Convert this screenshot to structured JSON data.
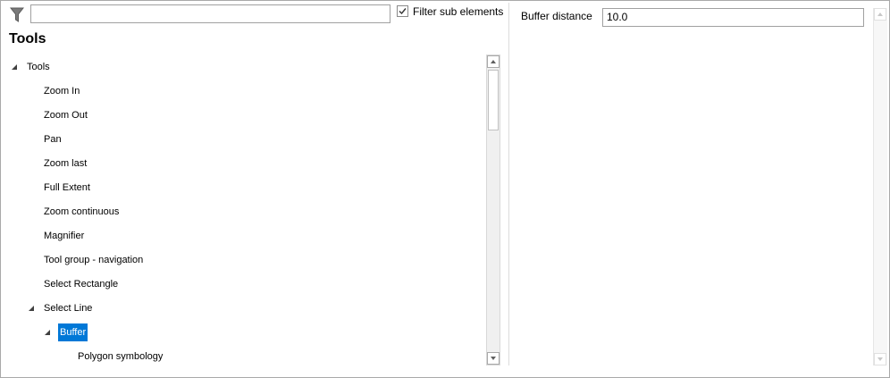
{
  "filter": {
    "icon": "funnel-filter-icon",
    "search_value": "",
    "checkbox_checked": true,
    "checkbox_label": "Filter sub elements"
  },
  "panel_title": "Tools",
  "tree": {
    "items": [
      {
        "label": "Tools",
        "level": 0,
        "expanded": true
      },
      {
        "label": "Zoom In",
        "level": 1,
        "expanded": null
      },
      {
        "label": "Zoom Out",
        "level": 1,
        "expanded": null
      },
      {
        "label": "Pan",
        "level": 1,
        "expanded": null
      },
      {
        "label": "Zoom last",
        "level": 1,
        "expanded": null
      },
      {
        "label": "Full Extent",
        "level": 1,
        "expanded": null
      },
      {
        "label": "Zoom continuous",
        "level": 1,
        "expanded": null
      },
      {
        "label": "Magnifier",
        "level": 1,
        "expanded": null
      },
      {
        "label": "Tool group - navigation",
        "level": 1,
        "expanded": null
      },
      {
        "label": "Select Rectangle",
        "level": 1,
        "expanded": null
      },
      {
        "label": "Select Line",
        "level": 1,
        "expanded": true
      },
      {
        "label": "Buffer",
        "level": 2,
        "expanded": true,
        "selected": true
      },
      {
        "label": "Polygon symbology",
        "level": 3,
        "expanded": null
      }
    ]
  },
  "properties": {
    "buffer_label": "Buffer distance",
    "buffer_value": "10.0"
  },
  "colors": {
    "selection": "#0078d7",
    "border": "#a9a9a9"
  }
}
